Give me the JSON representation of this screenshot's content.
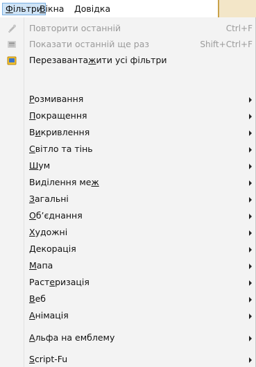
{
  "menubar": {
    "filters": {
      "pre": "",
      "ul": "Ф",
      "post": "ільтри"
    },
    "windows": {
      "pre": "",
      "ul": "В",
      "post": "ікна"
    },
    "help": {
      "pre": "",
      "ul": "Д",
      "post": "овідка"
    }
  },
  "menu": {
    "repeat_last": {
      "label": "Повторити останній",
      "shortcut": "Ctrl+F"
    },
    "reshow_last": {
      "label": "Показати останній ще раз",
      "shortcut": "Shift+Ctrl+F"
    },
    "reset_all": {
      "pre": "Перезаванта",
      "ul": "ж",
      "post": "ити усі фільтри"
    },
    "submenus": [
      {
        "pre": "",
        "ul": "Р",
        "post": "озмивання"
      },
      {
        "pre": "",
        "ul": "П",
        "post": "окращення"
      },
      {
        "pre": "В",
        "ul": "и",
        "post": "кривлення"
      },
      {
        "pre": "",
        "ul": "С",
        "post": "вітло та тінь"
      },
      {
        "pre": "",
        "ul": "Ш",
        "post": "ум"
      },
      {
        "pre": "Виділення ме",
        "ul": "ж",
        "post": ""
      },
      {
        "pre": "",
        "ul": "З",
        "post": "агальні"
      },
      {
        "pre": "",
        "ul": "О",
        "post": "б’єднання"
      },
      {
        "pre": "",
        "ul": "Х",
        "post": "удожні"
      },
      {
        "pre": "",
        "ul": "Д",
        "post": "екорація"
      },
      {
        "pre": "",
        "ul": "М",
        "post": "апа"
      },
      {
        "pre": "Раст",
        "ul": "е",
        "post": "ризація"
      },
      {
        "pre": "",
        "ul": "В",
        "post": "еб"
      },
      {
        "pre": "",
        "ul": "А",
        "post": "німація"
      }
    ],
    "alpha_to_logo": {
      "pre": "",
      "ul": "А",
      "post": "льфа на емблему"
    },
    "script_fu": {
      "pre": "",
      "ul": "S",
      "post": "cript-Fu"
    }
  },
  "icons": [
    "repeat-icon",
    "reshow-icon",
    "reset-filters-icon"
  ]
}
